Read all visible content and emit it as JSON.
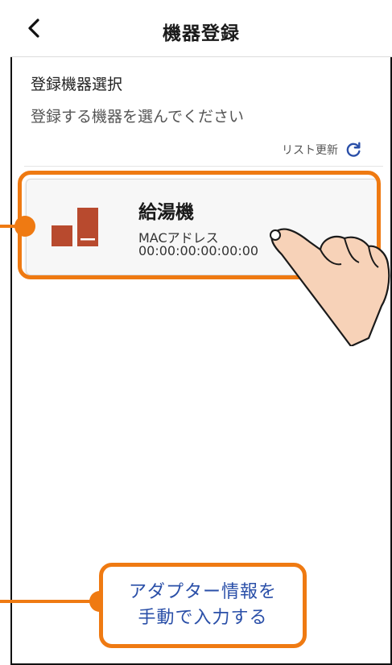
{
  "header": {
    "title": "機器登録",
    "back_icon": "chevron-left-icon"
  },
  "section": {
    "title": "登録機器選択",
    "subtitle": "登録する機器を選んでください"
  },
  "refresh": {
    "label": "リスト更新",
    "icon": "refresh-icon"
  },
  "device": {
    "name": "給湯機",
    "mac_label": "MACアドレス",
    "mac_value": "00:00:00:00:00:00",
    "icon": "water-heater-icon"
  },
  "manual": {
    "line1": "アダプター情報を",
    "line2": "手動で入力する"
  },
  "colors": {
    "accent": "#ef7a12",
    "link": "#2a4fa8",
    "device_icon": "#b84a2e",
    "refresh_icon": "#2a4fa8"
  }
}
